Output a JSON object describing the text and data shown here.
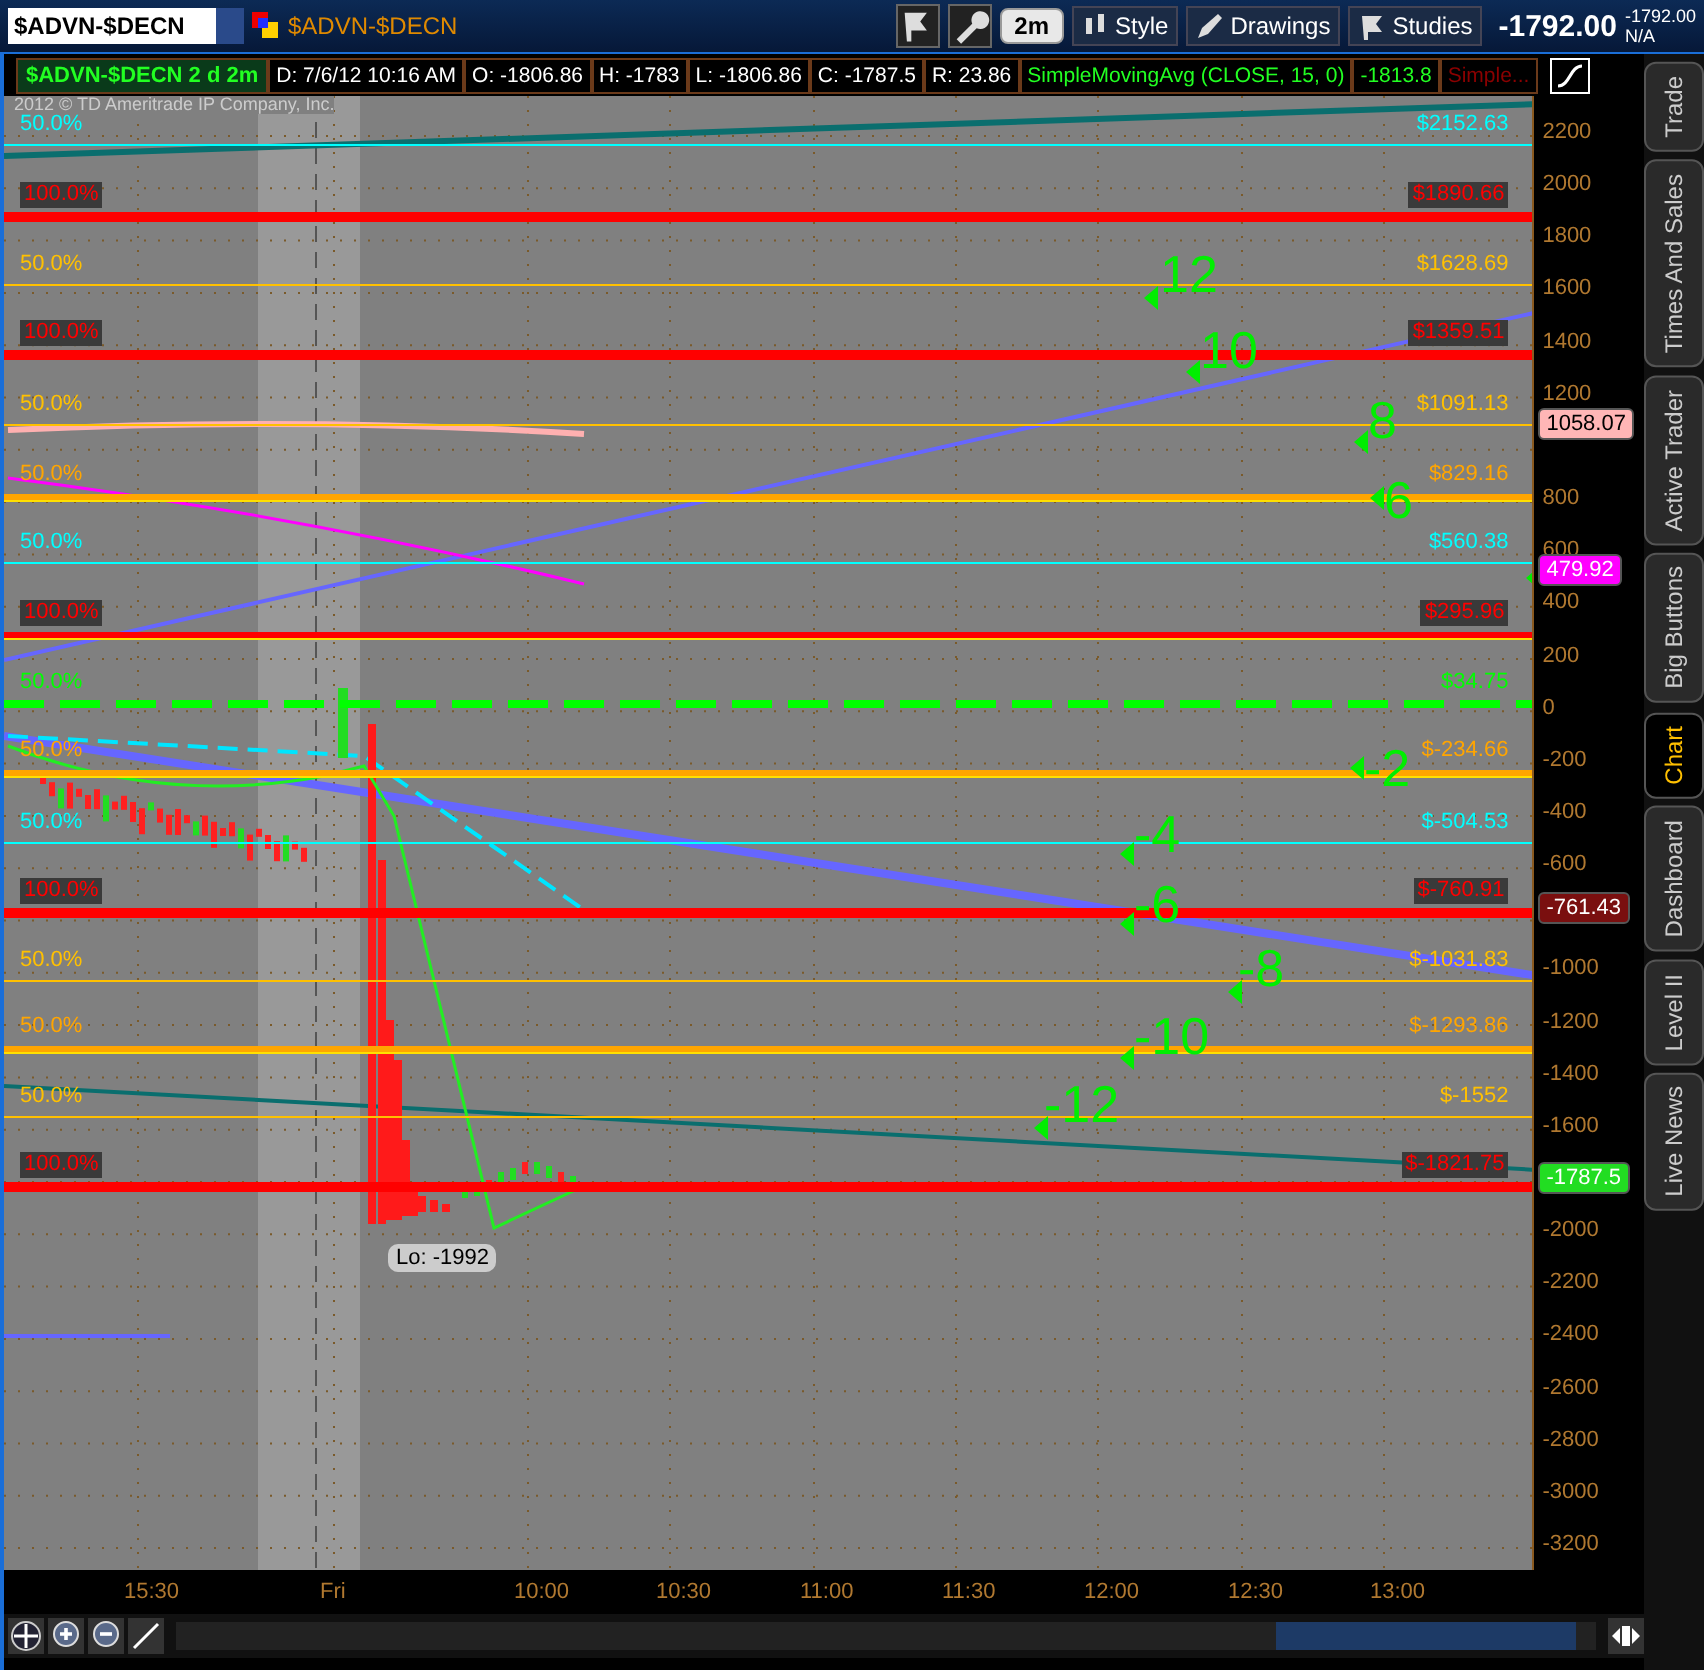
{
  "toolbar": {
    "symbol": "$ADVN-$DECN",
    "symbol_link": "$ADVN-$DECN",
    "aggregation": "2m",
    "buttons": [
      "Style",
      "Drawings",
      "Studies"
    ],
    "last_price": "-1792.00",
    "quote_small": "-1792.00",
    "quote_change": "N/A"
  },
  "info_bar": {
    "title": "$ADVN-$DECN 2 d 2m",
    "fields": [
      {
        "text": "D: 7/6/12 10:16 AM",
        "kind": "plain"
      },
      {
        "text": "O: -1806.86",
        "kind": "plain"
      },
      {
        "text": "H: -1783",
        "kind": "plain"
      },
      {
        "text": "L: -1806.86",
        "kind": "plain"
      },
      {
        "text": "C: -1787.5",
        "kind": "plain"
      },
      {
        "text": "R: 23.86",
        "kind": "plain"
      },
      {
        "text": "SimpleMovingAvg (CLOSE, 15, 0)",
        "kind": "study"
      },
      {
        "text": "-1813.8",
        "kind": "study"
      },
      {
        "text": "Simple...",
        "kind": "hidden_study"
      }
    ]
  },
  "chart": {
    "copyright": "2012 © TD Ameritrade IP Company, Inc.",
    "fib_levels": [
      {
        "left_label": "50.0%",
        "right_label": "$2152.63",
        "color": "#00ffff",
        "kind": "thin"
      },
      {
        "left_label": "100.0%",
        "right_label": "$1890.66",
        "color": "#ff0000",
        "kind": "thick"
      },
      {
        "left_label": "50.0%",
        "right_label": "$1628.69",
        "color": "#ffc000",
        "kind": "thin"
      },
      {
        "left_label": "100.0%",
        "right_label": "$1359.51",
        "color": "#ff0000",
        "kind": "thick"
      },
      {
        "left_label": "50.0%",
        "right_label": "$1091.13",
        "color": "#ffc000",
        "kind": "thin"
      },
      {
        "left_label": "50.0%",
        "right_label": "$829.16",
        "color": "#ffa500",
        "kind": "double"
      },
      {
        "left_label": "50.0%",
        "right_label": "$560.38",
        "color": "#00ffff",
        "kind": "thin"
      },
      {
        "left_label": "100.0%",
        "right_label": "$295.96",
        "color": "#ff0000",
        "kind": "double"
      },
      {
        "left_label": "50.0%",
        "right_label": "$34.75",
        "color": "#00ff00",
        "kind": "dashed"
      },
      {
        "left_label": "50.0%",
        "right_label": "$-234.66",
        "color": "#ffa500",
        "kind": "double"
      },
      {
        "left_label": "50.0%",
        "right_label": "$-504.53",
        "color": "#00ffff",
        "kind": "thin"
      },
      {
        "left_label": "100.0%",
        "right_label": "$-760.91",
        "color": "#ff0000",
        "kind": "thick"
      },
      {
        "left_label": "50.0%",
        "right_label": "$-1031.83",
        "color": "#ffc000",
        "kind": "thin"
      },
      {
        "left_label": "50.0%",
        "right_label": "$-1293.86",
        "color": "#ffa500",
        "kind": "double"
      },
      {
        "left_label": "50.0%",
        "right_label": "$-1552",
        "color": "#ffc000",
        "kind": "thin"
      },
      {
        "left_label": "100.0%",
        "right_label": "$-1821.75",
        "color": "#ff0000",
        "kind": "thick"
      }
    ],
    "markers": [
      {
        "label": "12"
      },
      {
        "label": "10"
      },
      {
        "label": "8"
      },
      {
        "label": "6"
      },
      {
        "label": "-2"
      },
      {
        "label": "-4"
      },
      {
        "label": "-6"
      },
      {
        "label": "-8"
      },
      {
        "label": "-10"
      },
      {
        "label": "-12"
      }
    ],
    "low_label": "Lo: -1992",
    "y_axis_ticks": [
      "2200",
      "2000",
      "1800",
      "1600",
      "1400",
      "1200",
      "800",
      "600",
      "400",
      "200",
      "0",
      "-200",
      "-400",
      "-600",
      "-1000",
      "-1200",
      "-1400",
      "-1600",
      "-2000",
      "-2200",
      "-2400",
      "-2600",
      "-2800",
      "-3000",
      "-3200"
    ],
    "price_badges": [
      {
        "text": "1058.07",
        "color": "#ffb6b6"
      },
      {
        "text": "479.92",
        "color": "#ff00ff"
      },
      {
        "text": "-761.43",
        "color": "#7a0f0f"
      },
      {
        "text": "-1787.5",
        "color": "#22dd22"
      }
    ],
    "time_labels": [
      "15:30",
      "Fri",
      "10:00",
      "10:30",
      "11:00",
      "11:30",
      "12:00",
      "12:30",
      "13:00"
    ]
  },
  "side_tabs": [
    {
      "label": "Trade",
      "selected": false
    },
    {
      "label": "Times And Sales",
      "selected": false
    },
    {
      "label": "Active Trader",
      "selected": false
    },
    {
      "label": "Big Buttons",
      "selected": false
    },
    {
      "label": "Chart",
      "selected": true
    },
    {
      "label": "Dashboard",
      "selected": false
    },
    {
      "label": "Level II",
      "selected": false
    },
    {
      "label": "Live News",
      "selected": false
    }
  ]
}
